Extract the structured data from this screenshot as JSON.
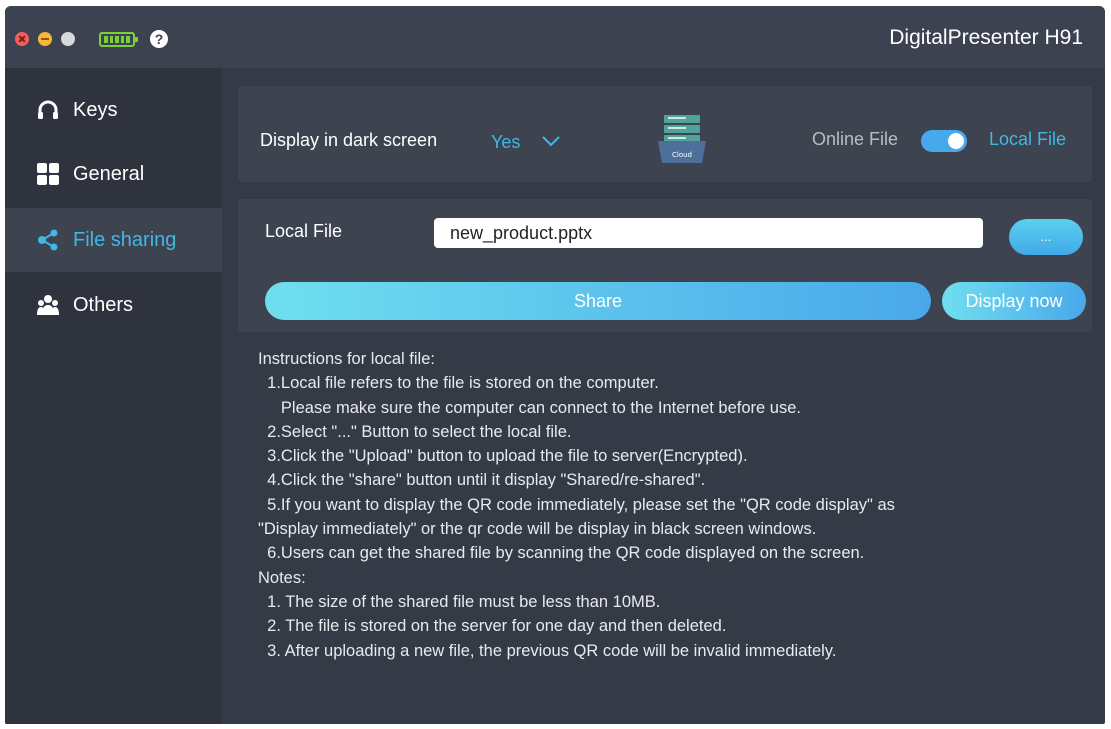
{
  "window": {
    "title": "DigitalPresenter H91",
    "help_glyph": "?"
  },
  "sidebar": {
    "items": [
      {
        "label": "Keys",
        "icon": "headset-icon"
      },
      {
        "label": "General",
        "icon": "grid-icon"
      },
      {
        "label": "File sharing",
        "icon": "share-icon",
        "active": true
      },
      {
        "label": "Others",
        "icon": "group-icon"
      }
    ]
  },
  "settings": {
    "dark_screen_label": "Display in dark screen",
    "dark_screen_value": "Yes",
    "cloud_label": "Cloud",
    "online_file_label": "Online File",
    "local_file_label": "Local File",
    "toggle_on": true
  },
  "file": {
    "label": "Local File",
    "value": "new_product.pptx",
    "browse_label": "...",
    "share_label": "Share",
    "display_now_label": "Display now"
  },
  "instructions": {
    "lines": [
      "Instructions for local file:",
      "  1.Local file refers to the file is stored on the computer.",
      "     Please make sure the computer can connect to the Internet before use.",
      "  2.Select \"...\" Button to select the local file.",
      "  3.Click the \"Upload\" button to upload the file to server(Encrypted).",
      "  4.Click the \"share\" button until it display \"Shared/re-shared\".",
      "  5.If you want to display the QR code immediately, please set the \"QR code display\" as",
      "\"Display immediately\" or the qr code will be display in black screen windows.",
      "  6.Users can get the shared file by scanning the QR code displayed on the screen.",
      "Notes:",
      "  1. The size of the shared file must be less than 10MB.",
      "  2. The file is stored on the server for one day and then deleted.",
      "  3. After uploading a new file, the previous QR code will be invalid immediately."
    ]
  },
  "colors": {
    "accent": "#3fb8e6",
    "background": "#353a47",
    "panel": "#3e4350",
    "sidebar": "#2f333e"
  }
}
